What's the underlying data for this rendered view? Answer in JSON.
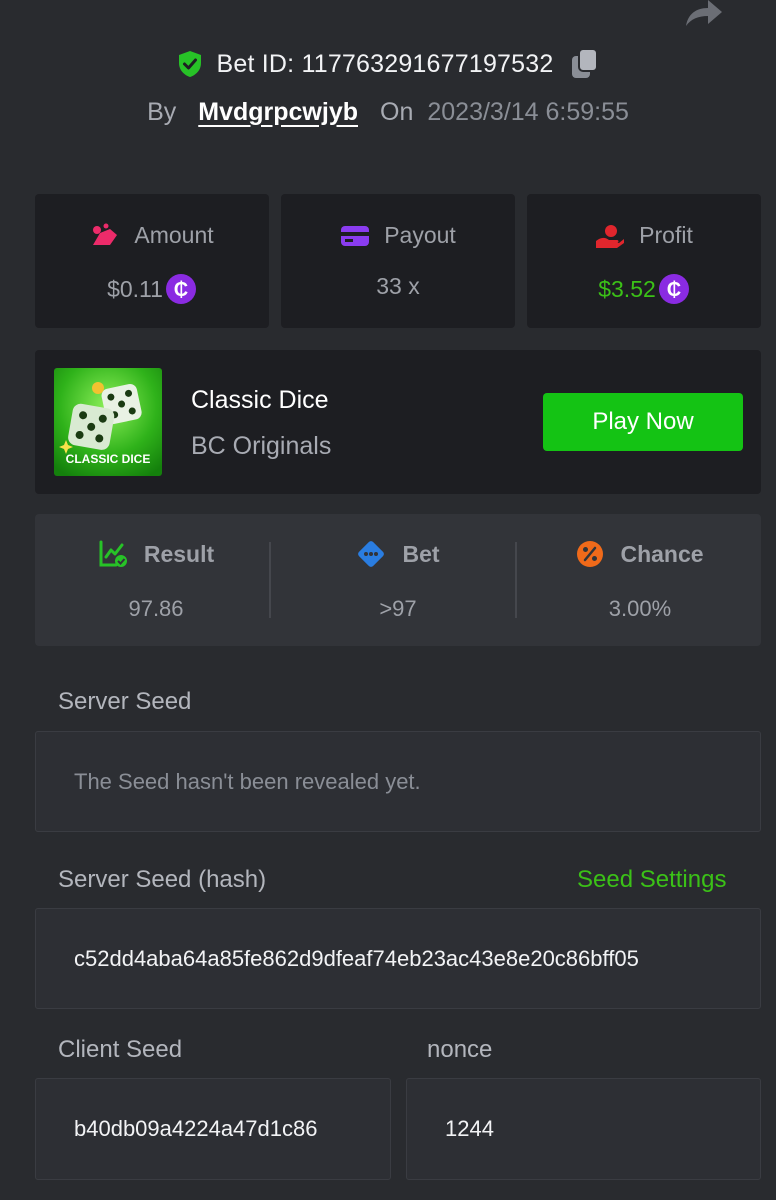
{
  "header": {
    "bet_id": "Bet ID: 117763291677197532",
    "by_label": "By",
    "username": "Mvdgrpcwjyb",
    "on_label": "On",
    "date": "2023/3/14 6:59:55"
  },
  "stats": {
    "amount": {
      "label": "Amount",
      "value": "$0.11"
    },
    "payout": {
      "label": "Payout",
      "value": "33 x"
    },
    "profit": {
      "label": "Profit",
      "value": "$3.52"
    }
  },
  "game": {
    "thumb_text": "CLASSIC DICE",
    "name": "Classic Dice",
    "provider": "BC Originals",
    "play_label": "Play Now"
  },
  "result": {
    "result": {
      "label": "Result",
      "value": "97.86"
    },
    "bet": {
      "label": "Bet",
      "value": ">97"
    },
    "chance": {
      "label": "Chance",
      "value": "3.00%"
    }
  },
  "seeds": {
    "server_seed_label": "Server Seed",
    "server_seed_value": "The Seed hasn't been revealed yet.",
    "server_hash_label": "Server Seed (hash)",
    "seed_settings_label": "Seed Settings",
    "server_hash_value": "c52dd4aba64a85fe862d9dfeaf74eb23ac43e8e20c86bff05",
    "client_seed_label": "Client Seed",
    "client_seed_value": "b40db09a4224a47d1c86",
    "nonce_label": "nonce",
    "nonce_value": "1244"
  },
  "colors": {
    "background": "#292b2f",
    "card": "#1d1e22",
    "accent_green": "#3bc117",
    "play_button": "#14c314",
    "coin_purple": "#8a2be2"
  },
  "icons": [
    "share-icon",
    "shield-check-icon",
    "copy-icon",
    "amount-icon",
    "payout-card-icon",
    "profit-hand-icon",
    "coin-icon",
    "result-chart-icon",
    "bet-dice-icon",
    "chance-percent-icon"
  ]
}
